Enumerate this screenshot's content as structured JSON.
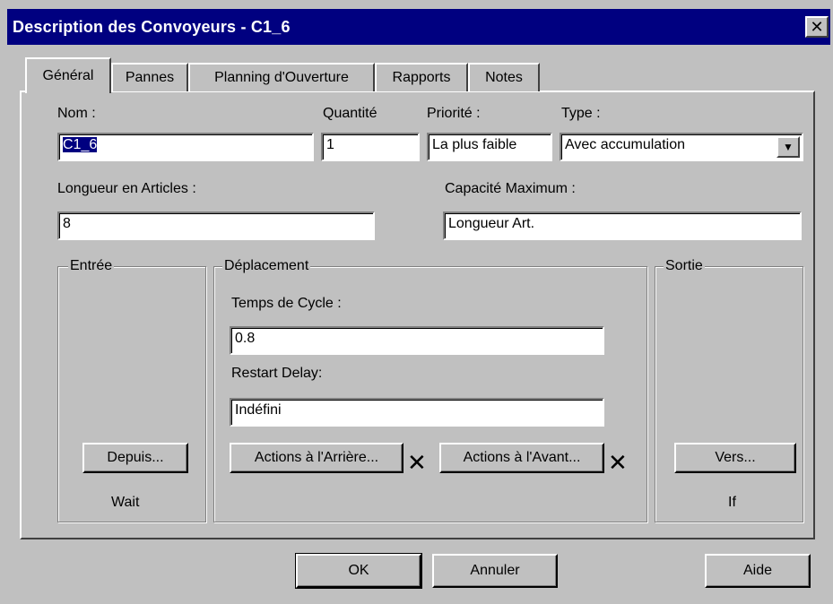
{
  "window": {
    "title": "Description des Convoyeurs - C1_6",
    "close_glyph": "✕"
  },
  "tabs": [
    {
      "label": "Général",
      "active": true
    },
    {
      "label": "Pannes",
      "active": false
    },
    {
      "label": "Planning d'Ouverture",
      "active": false
    },
    {
      "label": "Rapports",
      "active": false
    },
    {
      "label": "Notes",
      "active": false
    }
  ],
  "general": {
    "nom": {
      "label": "Nom :",
      "value": "C1_6"
    },
    "quantite": {
      "label": "Quantité",
      "value": "1"
    },
    "priorite": {
      "label": "Priorité :",
      "value": "La plus faible"
    },
    "type": {
      "label": "Type :",
      "value": "Avec accumulation",
      "arrow": "▼"
    },
    "longueur": {
      "label": "Longueur en Articles :",
      "value": "8"
    },
    "capacite": {
      "label": "Capacité Maximum :",
      "value": "Longueur Art."
    }
  },
  "entree": {
    "title": "Entrée",
    "button": "Depuis...",
    "status": "Wait"
  },
  "deplacement": {
    "title": "Déplacement",
    "cycle": {
      "label": "Temps de Cycle :",
      "value": "0.8"
    },
    "restart": {
      "label": "Restart Delay:",
      "value": "Indéfini"
    },
    "arriere_button": "Actions à l'Arrière...",
    "avant_button": "Actions à l'Avant...",
    "x_mark": "✕"
  },
  "sortie": {
    "title": "Sortie",
    "button": "Vers...",
    "status": "If"
  },
  "footer": {
    "ok": "OK",
    "annuler": "Annuler",
    "aide": "Aide"
  }
}
